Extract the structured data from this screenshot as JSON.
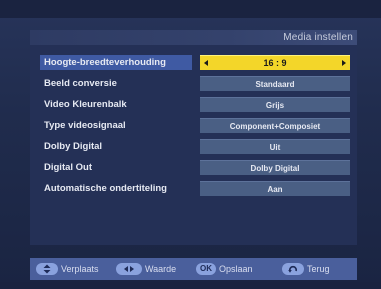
{
  "header": {
    "title": "Media instellen"
  },
  "settings": [
    {
      "label": "Hoogte-breedteverhouding",
      "value": "16 : 9",
      "selected": true
    },
    {
      "label": "Beeld conversie",
      "value": "Standaard",
      "selected": false
    },
    {
      "label": "Video Kleurenbalk",
      "value": "Grijs",
      "selected": false
    },
    {
      "label": "Type videosignaal",
      "value": "Component+Composiet",
      "selected": false
    },
    {
      "label": "Dolby Digital",
      "value": "Uit",
      "selected": false
    },
    {
      "label": "Digital Out",
      "value": "Dolby Digital",
      "selected": false
    },
    {
      "label": "Automatische ondertiteling",
      "value": "Aan",
      "selected": false
    }
  ],
  "footer": {
    "move_label": "Verplaats",
    "value_label": "Waarde",
    "ok_key": "OK",
    "save_label": "Opslaan",
    "back_label": "Terug"
  },
  "icons": {
    "move": "up-down-icon",
    "value": "left-right-icon",
    "back": "back-arrow-icon"
  },
  "colors": {
    "highlight": "#f3d629",
    "selected_label_bg": "#3f5aa3",
    "value_bg": "#4a5f84",
    "footer_bg": "#4a5f9c"
  }
}
